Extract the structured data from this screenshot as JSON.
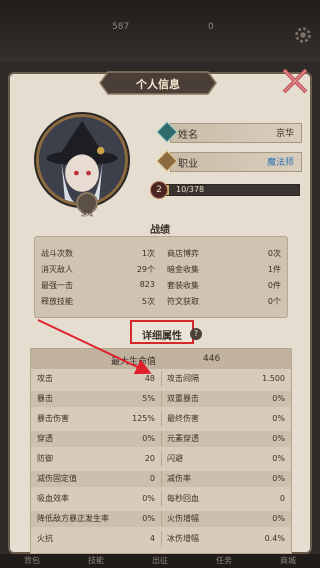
{
  "topbar": {
    "res_left": "587",
    "res_right": "0"
  },
  "header": {
    "title": "个人信息"
  },
  "profile": {
    "avatar_badge": "游戏",
    "name_label": "姓名",
    "name_value": "京华",
    "class_label": "职业",
    "class_value": "魔法师",
    "level": "2",
    "exp_text": "10/378",
    "exp_fraction": 0.03
  },
  "battle": {
    "title": "战绩",
    "rows": [
      {
        "l1": "战斗次数",
        "v1": "1次",
        "l2": "商店博弈",
        "v2": "0次"
      },
      {
        "l1": "消灭敌人",
        "v1": "29个",
        "l2": "暗金收集",
        "v2": "1件"
      },
      {
        "l1": "最强一击",
        "v1": "823",
        "l2": "套装收集",
        "v2": "0件"
      },
      {
        "l1": "释放技能",
        "v1": "5次",
        "l2": "符文获取",
        "v2": "0个"
      }
    ]
  },
  "detail": {
    "button_label": "详细属性",
    "help": "?",
    "head_label": "最大生命值",
    "head_value": "446",
    "rows": [
      {
        "l1": "攻击",
        "v1": "48",
        "l2": "攻击间隔",
        "v2": "1.500"
      },
      {
        "l1": "暴击",
        "v1": "5%",
        "l2": "双重暴击",
        "v2": "0%"
      },
      {
        "l1": "暴击伤害",
        "v1": "125%",
        "l2": "最终伤害",
        "v2": "0%"
      },
      {
        "l1": "穿透",
        "v1": "0%",
        "l2": "元素穿透",
        "v2": "0%"
      },
      {
        "l1": "防御",
        "v1": "20",
        "l2": "闪避",
        "v2": "0%"
      },
      {
        "l1": "减伤固定值",
        "v1": "0",
        "l2": "减伤率",
        "v2": "0%"
      },
      {
        "l1": "吸血效率",
        "v1": "0%",
        "l2": "每秒回血",
        "v2": "0"
      },
      {
        "l1": "降低敌方暴正发生率",
        "v1": "0%",
        "l2": "火伤增幅",
        "v2": "0%"
      },
      {
        "l1": "火抗",
        "v1": "4",
        "l2": "冰伤增幅",
        "v2": "0.4%"
      }
    ]
  },
  "nav": [
    "背包",
    "技能",
    "出征",
    "任务",
    "商城"
  ],
  "colors": {
    "highlight": "#d8262a",
    "accent_blue": "#2f6fb3",
    "panel_bg": "#e4ddd0"
  }
}
